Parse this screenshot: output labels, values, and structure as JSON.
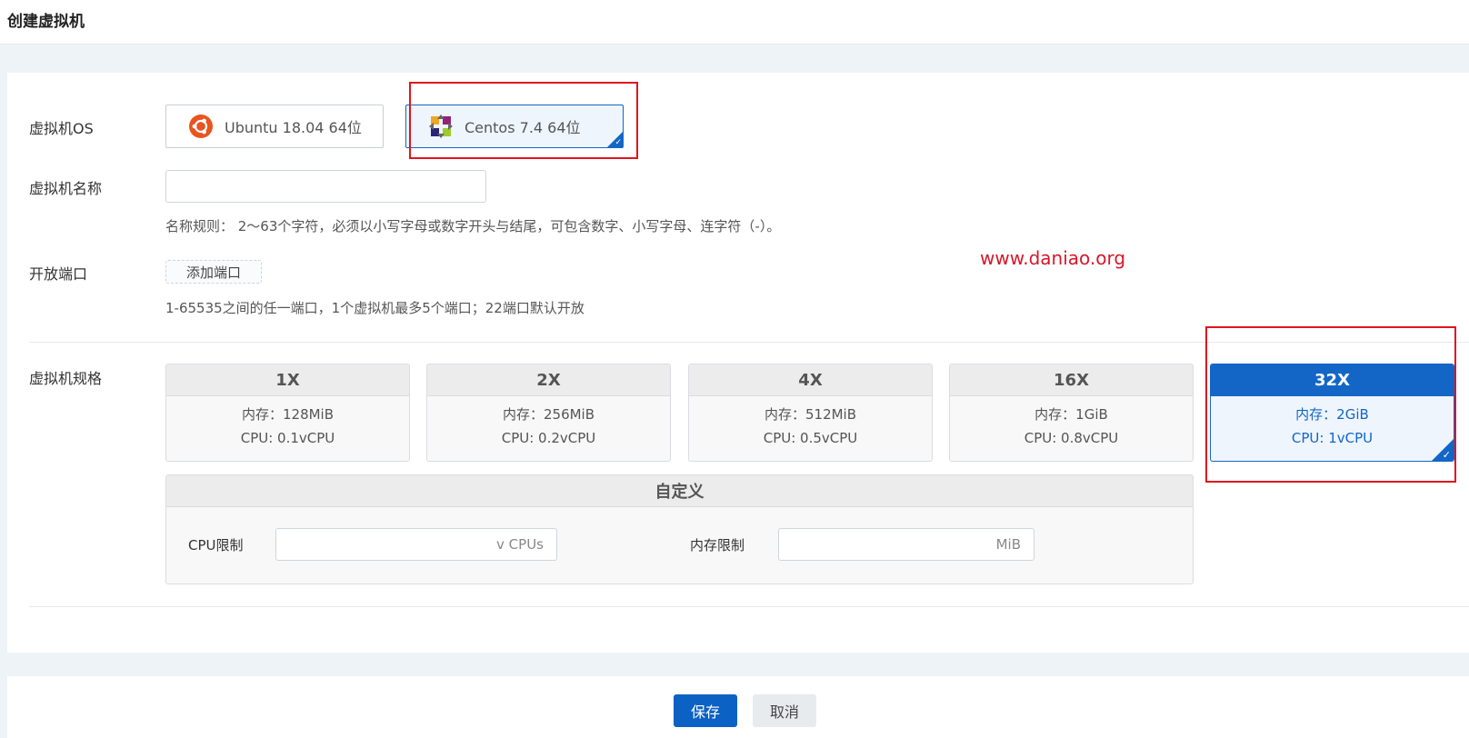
{
  "page": {
    "title": "创建虚拟机"
  },
  "os": {
    "label": "虚拟机OS",
    "options": [
      {
        "name": "Ubuntu 18.04 64位",
        "icon": "ubuntu-logo-icon",
        "selected": false
      },
      {
        "name": "Centos 7.4 64位",
        "icon": "centos-logo-icon",
        "selected": true
      }
    ]
  },
  "vm_name": {
    "label": "虚拟机名称",
    "value": "",
    "hint": "名称规则： 2～63个字符，必须以小写字母或数字开头与结尾，可包含数字、小写字母、连字符（-）。"
  },
  "ports": {
    "label": "开放端口",
    "add_button": "添加端口",
    "hint": "1-65535之间的任一端口，1个虚拟机最多5个端口；22端口默认开放"
  },
  "watermark": "www.daniao.org",
  "spec": {
    "label": "虚拟机规格",
    "options": [
      {
        "name": "1X",
        "memory": "内存：128MiB",
        "cpu": "CPU: 0.1vCPU",
        "selected": false
      },
      {
        "name": "2X",
        "memory": "内存：256MiB",
        "cpu": "CPU: 0.2vCPU",
        "selected": false
      },
      {
        "name": "4X",
        "memory": "内存：512MiB",
        "cpu": "CPU: 0.5vCPU",
        "selected": false
      },
      {
        "name": "16X",
        "memory": "内存：1GiB",
        "cpu": "CPU: 0.8vCPU",
        "selected": false
      },
      {
        "name": "32X",
        "memory": "内存：2GiB",
        "cpu": "CPU: 1vCPU",
        "selected": true
      }
    ],
    "custom": {
      "title": "自定义",
      "cpu_label": "CPU限制",
      "cpu_unit": "v CPUs",
      "memory_label": "内存限制",
      "memory_unit": "MiB"
    }
  },
  "actions": {
    "save": "保存",
    "cancel": "取消"
  },
  "colors": {
    "accent": "#1366c6",
    "highlight_box": "#e0141e"
  }
}
